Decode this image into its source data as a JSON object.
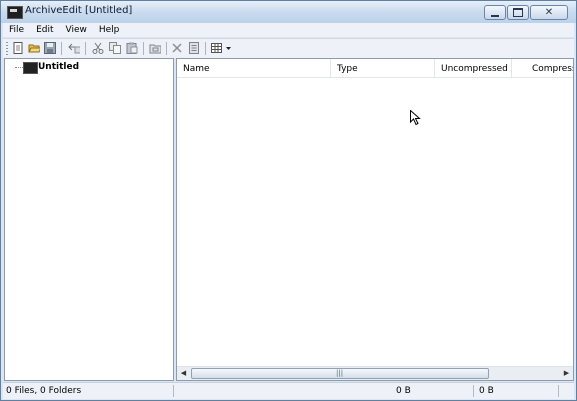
{
  "window": {
    "title": "ArchiveEdit [Untitled]"
  },
  "menu": [
    "File",
    "Edit",
    "View",
    "Help"
  ],
  "toolbar": {
    "buttons": [
      "new-icon",
      "open-icon",
      "save-icon",
      "up-folder-icon",
      "cut-icon",
      "copy-icon",
      "paste-icon",
      "new-folder-icon",
      "delete-icon",
      "properties-icon",
      "view-mode-icon"
    ]
  },
  "tree": {
    "root_label": "Untitled"
  },
  "list": {
    "columns": [
      "Name",
      "Type",
      "Uncompressed",
      "Compress"
    ]
  },
  "status": {
    "summary": "0 Files, 0 Folders",
    "uncompressed_size": "0 B",
    "compressed_size": "0 B"
  },
  "colors": {
    "window_frame": "#dae6f3",
    "titlebar": "#c9dbee",
    "pane_bg": "#ffffff"
  }
}
